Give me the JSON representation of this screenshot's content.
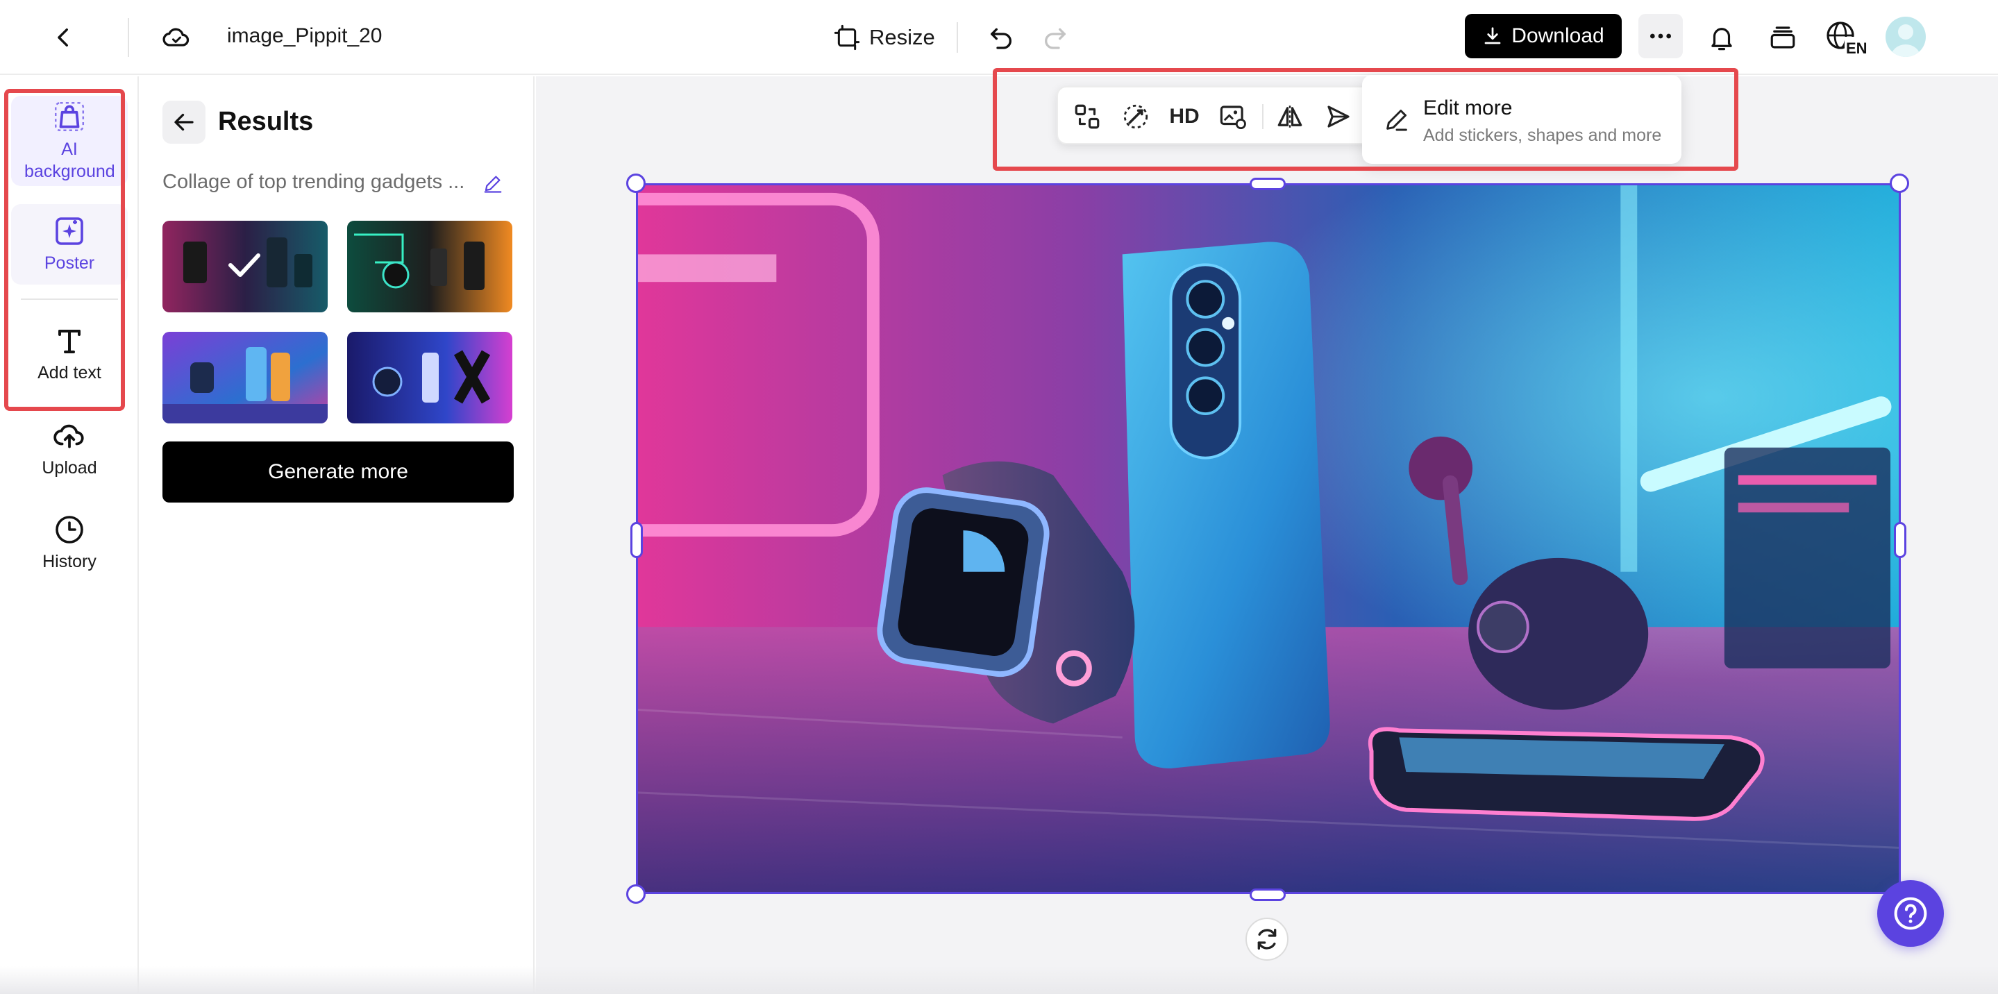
{
  "header": {
    "project_title": "image_Pippit_20",
    "resize_label": "Resize",
    "download_label": "Download",
    "language": "EN"
  },
  "rail": {
    "items": [
      {
        "label": "AI background",
        "icon": "bag-icon"
      },
      {
        "label": "Poster",
        "icon": "poster-icon"
      },
      {
        "label": "Add text",
        "icon": "text-icon"
      },
      {
        "label": "Upload",
        "icon": "upload-icon"
      },
      {
        "label": "History",
        "icon": "clock-icon"
      }
    ]
  },
  "results": {
    "title": "Results",
    "prompt": "Collage of top trending gadgets ...",
    "generate_more_label": "Generate more",
    "selected_index": 0
  },
  "toolbar": {
    "hd_label": "HD",
    "tools": [
      "swap-icon",
      "magic-eraser-icon",
      "hd-icon",
      "replace-image-icon",
      "flip-icon",
      "send-icon"
    ]
  },
  "edit_more": {
    "title": "Edit more",
    "subtitle": "Add stickers, shapes and more"
  },
  "colors": {
    "accent": "#5b43e0",
    "highlight": "#e5484d",
    "neon_pink": "#ff3fb4",
    "neon_cyan": "#2ee6ff"
  }
}
